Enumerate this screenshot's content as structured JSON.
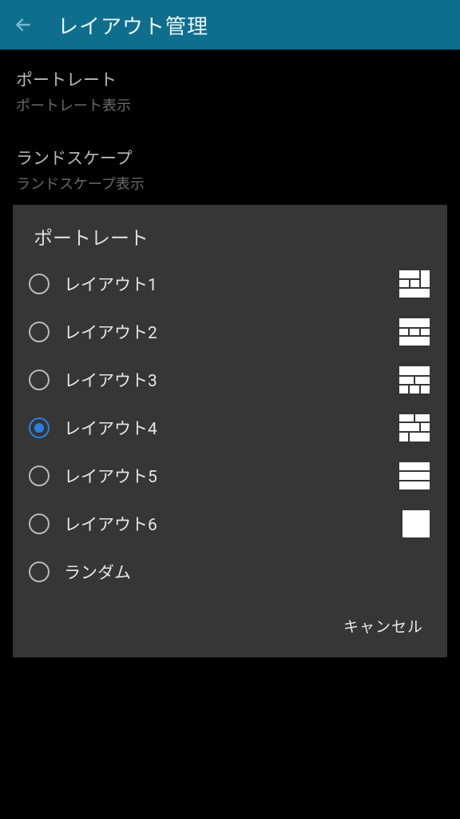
{
  "appbar": {
    "title": "レイアウト管理"
  },
  "background": {
    "items": [
      {
        "primary": "ポートレート",
        "secondary": "ポートレート表示"
      },
      {
        "primary": "ランドスケープ",
        "secondary": "ランドスケープ表示"
      }
    ]
  },
  "dialog": {
    "title": "ポートレート",
    "options": [
      {
        "label": "レイアウト1",
        "selected": false,
        "thumb": "layout1"
      },
      {
        "label": "レイアウト2",
        "selected": false,
        "thumb": "layout2"
      },
      {
        "label": "レイアウト3",
        "selected": false,
        "thumb": "layout3"
      },
      {
        "label": "レイアウト4",
        "selected": true,
        "thumb": "layout4"
      },
      {
        "label": "レイアウト5",
        "selected": false,
        "thumb": "layout5"
      },
      {
        "label": "レイアウト6",
        "selected": false,
        "thumb": "layout6"
      },
      {
        "label": "ランダム",
        "selected": false,
        "thumb": null
      }
    ],
    "cancel": "キャンセル"
  },
  "colors": {
    "appbar": "#0f6e8e",
    "dialog": "#363636",
    "accent": "#2b7fe0"
  }
}
